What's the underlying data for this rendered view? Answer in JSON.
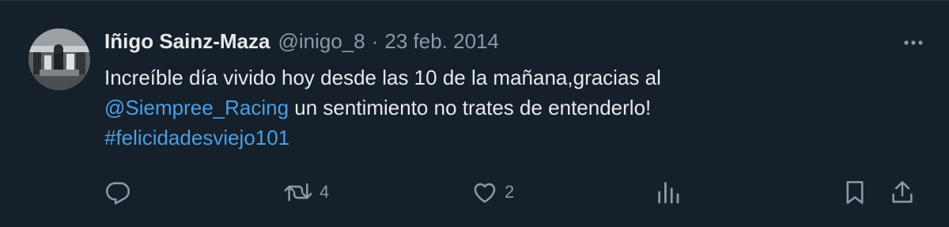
{
  "author": {
    "display_name": "Iñigo Sainz-Maza",
    "handle": "@inigo_8",
    "separator": "·",
    "date": "23 feb. 2014",
    "avatar": "user-avatar-photo"
  },
  "tweet": {
    "text_part1": "Increíble día vivido hoy desde las 10 de la mañana,gracias al",
    "mention": "@Siempree_Racing",
    "text_part2": " un sentimiento no trates de entenderlo!",
    "hashtag": "#felicidadesviejo101"
  },
  "actions": {
    "reply": {
      "icon": "reply-icon",
      "count": ""
    },
    "retweet": {
      "icon": "retweet-icon",
      "count": "4"
    },
    "like": {
      "icon": "heart-icon",
      "count": "2"
    },
    "views": {
      "icon": "views-chart-icon",
      "count": ""
    },
    "bookmark": {
      "icon": "bookmark-icon"
    },
    "share": {
      "icon": "share-icon"
    }
  },
  "more_menu": {
    "icon": "more-options-icon"
  },
  "colors": {
    "background": "#16202a",
    "primary_text": "#e7e9ea",
    "secondary_text": "#8b98a5",
    "link": "#4a9fe6"
  }
}
